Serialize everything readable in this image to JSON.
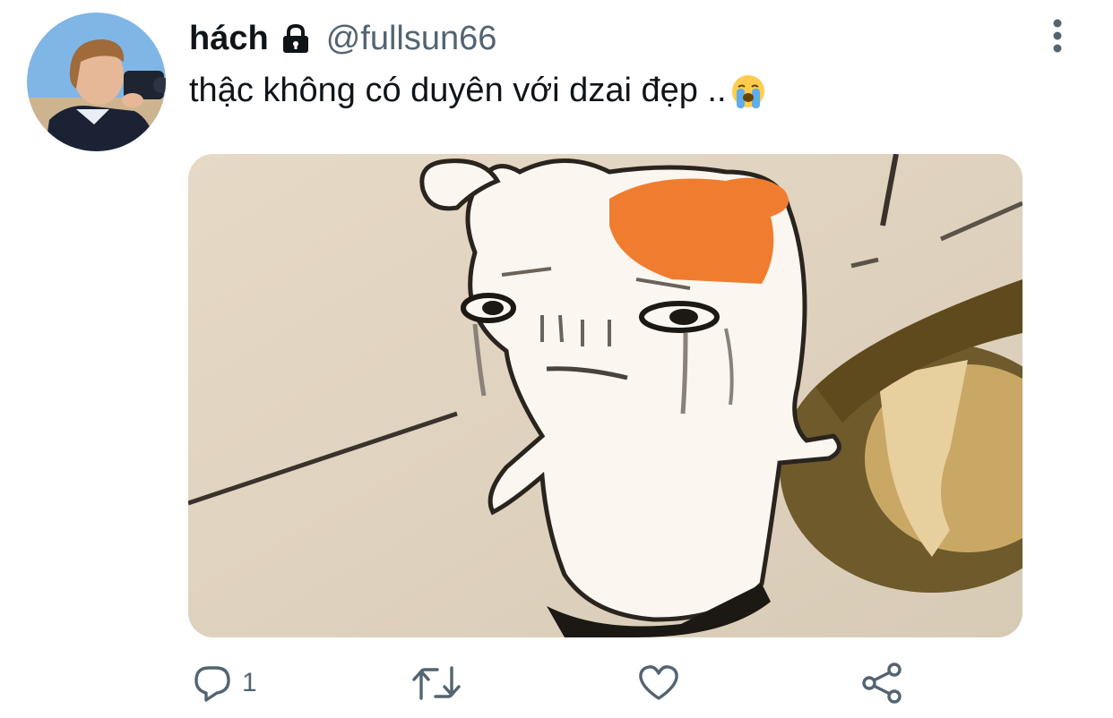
{
  "tweet": {
    "display_name": "hách",
    "handle": "@fullsun66",
    "text": "thậc không có duyên với dzai đẹp ..",
    "emoji": "loudly-crying-face-emoji",
    "locked": true
  },
  "actions": {
    "reply_count": "1",
    "reply_icon": "reply-icon",
    "retweet_icon": "retweet-icon",
    "like_icon": "like-icon",
    "share_icon": "share-icon"
  },
  "colors": {
    "text_primary": "#0f1419",
    "text_secondary": "#536471",
    "icon": "#536471"
  }
}
